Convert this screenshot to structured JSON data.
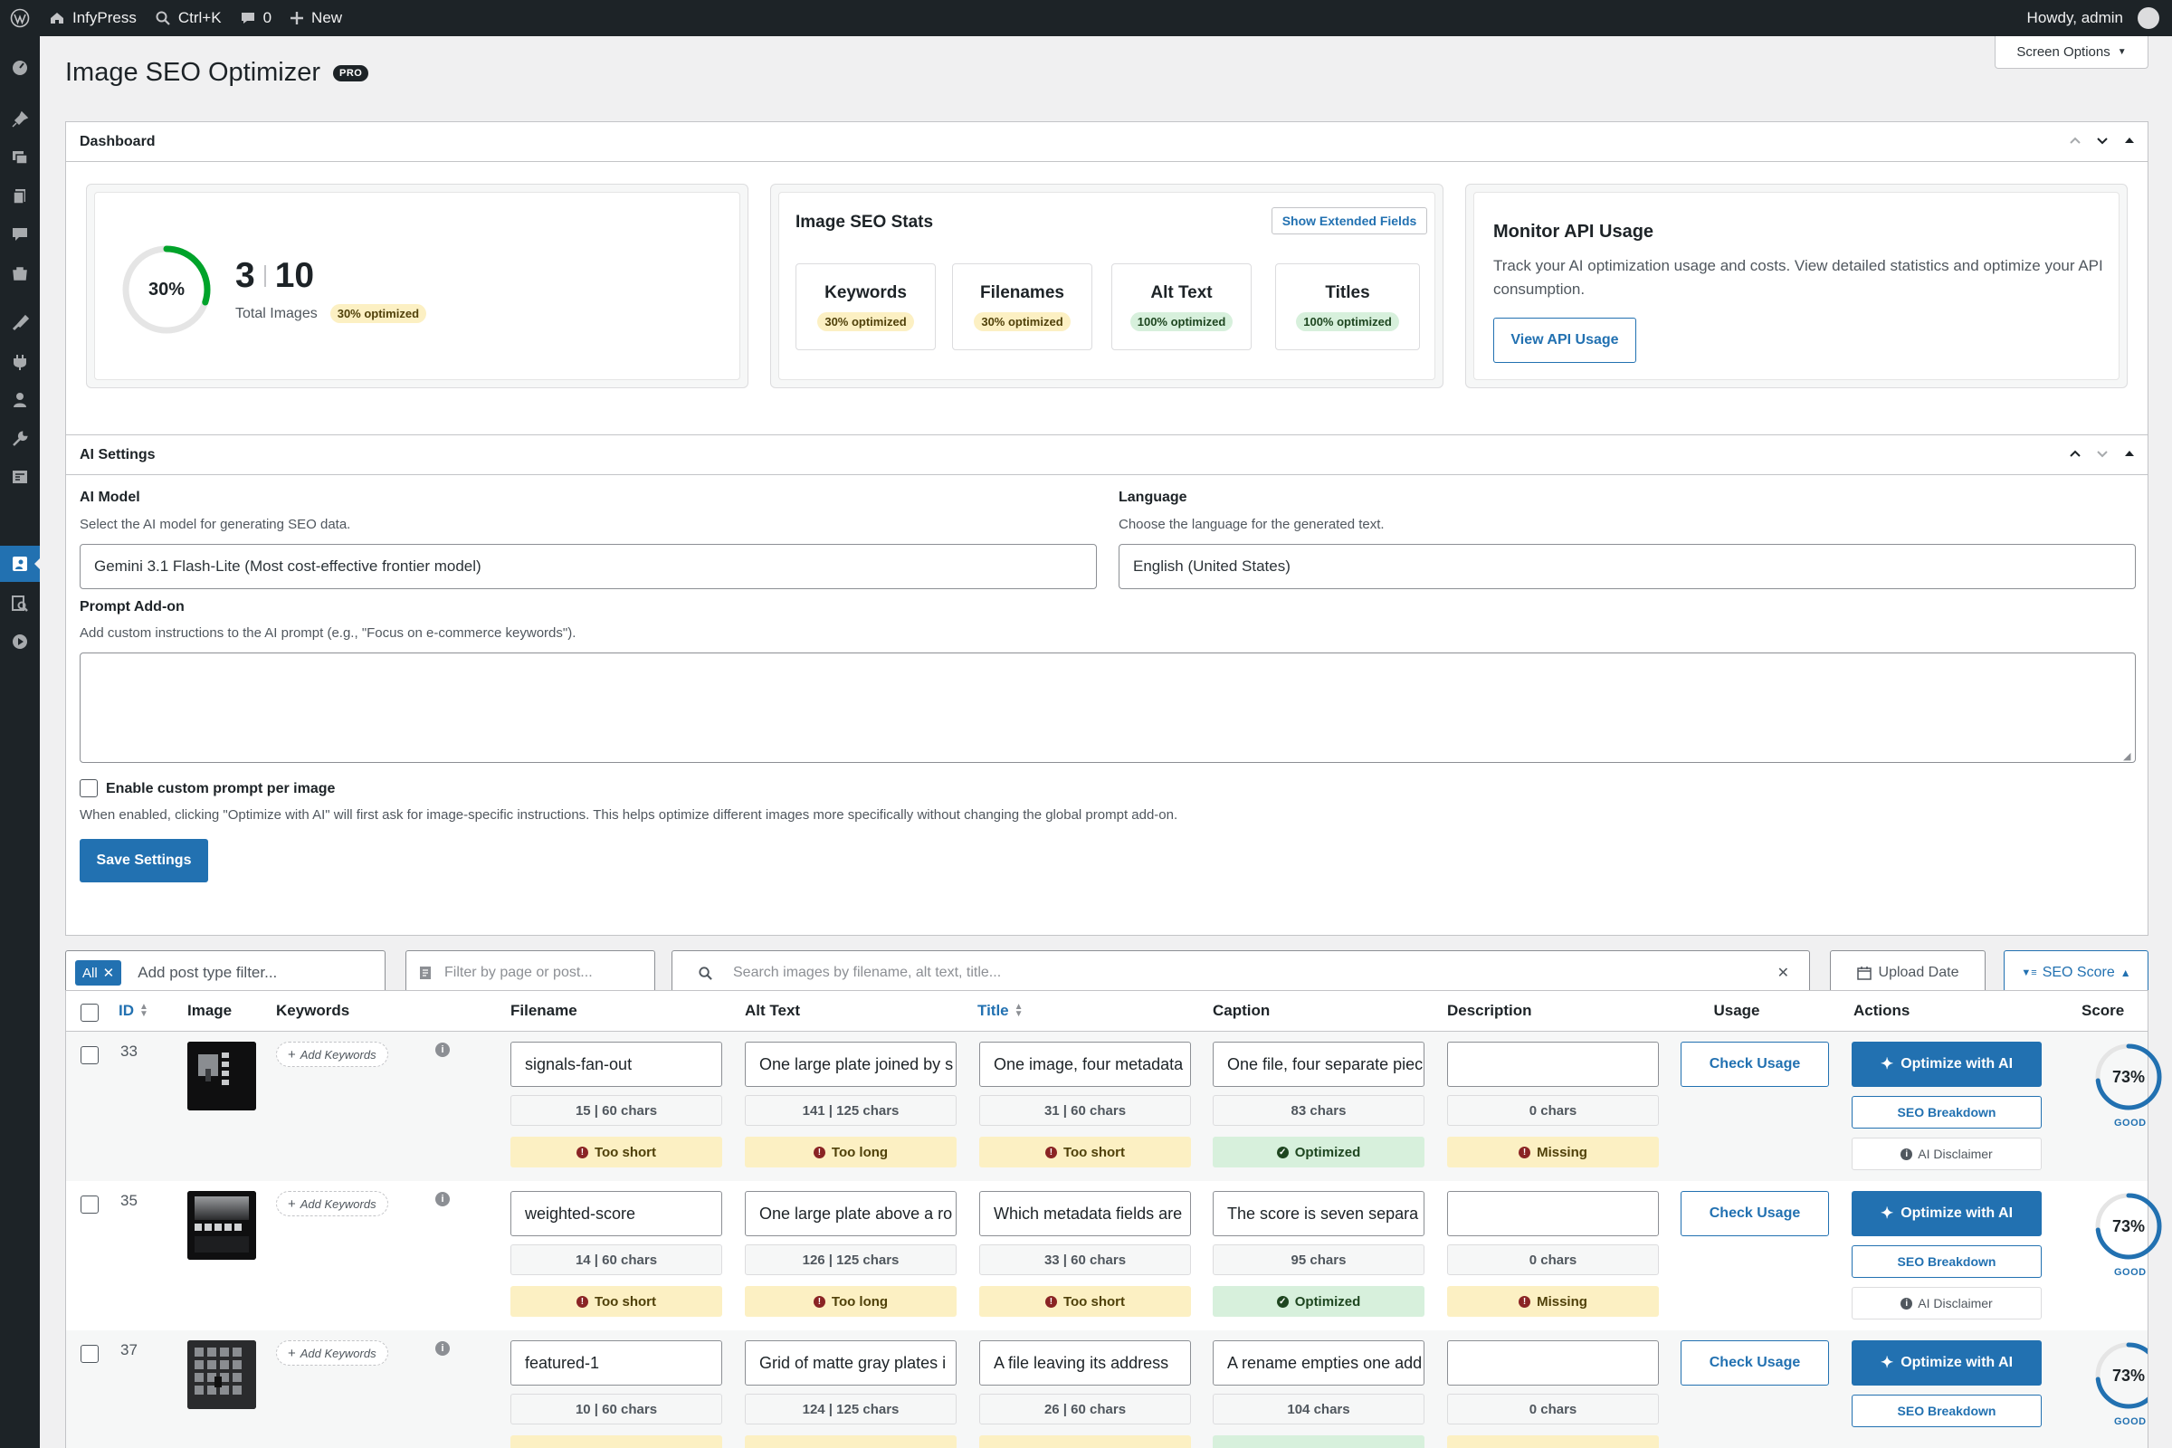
{
  "adminbar": {
    "site_name": "InfyPress",
    "search_shortcut": "Ctrl+K",
    "comments_count": "0",
    "new_label": "New",
    "howdy": "Howdy, admin"
  },
  "page": {
    "title": "Image SEO Optimizer",
    "pro_badge": "PRO",
    "screen_options": "Screen Options"
  },
  "dashboard": {
    "title": "Dashboard",
    "progress_percent_label": "30%",
    "progress_fraction": 0.3,
    "optimized_count": "3",
    "total_count": "10",
    "total_images_label": "Total Images",
    "optimized_badge": "30% optimized",
    "stats_title": "Image SEO Stats",
    "show_extended_fields": "Show Extended Fields",
    "stats": [
      {
        "label": "Keywords",
        "badge": "30% optimized"
      },
      {
        "label": "Filenames",
        "badge": "30% optimized"
      },
      {
        "label": "Alt Text",
        "badge": "100% optimized"
      },
      {
        "label": "Titles",
        "badge": "100% optimized"
      }
    ],
    "api_title": "Monitor API Usage",
    "api_desc": "Track your AI optimization usage and costs. View detailed statistics and optimize your API consumption.",
    "api_button": "View API Usage"
  },
  "ai_settings": {
    "title": "AI Settings",
    "model_label": "AI Model",
    "model_desc": "Select the AI model for generating SEO data.",
    "model_value": "Gemini 3.1 Flash-Lite (Most cost-effective frontier model)",
    "language_label": "Language",
    "language_desc": "Choose the language for the generated text.",
    "language_value": "English (United States)",
    "prompt_label": "Prompt Add-on",
    "prompt_desc": "Add custom instructions to the AI prompt (e.g., \"Focus on e-commerce keywords\").",
    "prompt_value": "",
    "custom_prompt_label": "Enable custom prompt per image",
    "custom_prompt_desc": "When enabled, clicking \"Optimize with AI\" will first ask for image-specific instructions. This helps optimize different images more specifically without changing the global prompt add-on.",
    "save_button": "Save Settings"
  },
  "filters": {
    "all_tag": "All",
    "post_type_placeholder": "Add post type filter...",
    "page_filter_placeholder": "Filter by page or post...",
    "search_placeholder": "Search images by filename, alt text, title...",
    "upload_date": "Upload Date",
    "seo_score": "SEO Score"
  },
  "table": {
    "headers": {
      "id": "ID",
      "image": "Image",
      "keywords": "Keywords",
      "filename": "Filename",
      "alt": "Alt Text",
      "title": "Title",
      "caption": "Caption",
      "description": "Description",
      "usage": "Usage",
      "actions": "Actions",
      "score": "Score"
    },
    "add_keywords": "Add Keywords",
    "check_usage": "Check Usage",
    "optimize": "Optimize with AI",
    "seo_breakdown": "SEO Breakdown",
    "ai_disclaimer": "AI Disclaimer",
    "rows": [
      {
        "id": "33",
        "filename": "signals-fan-out",
        "filename_chars": "15 | 60 chars",
        "filename_status": "Too short",
        "alt": "One large plate joined by s",
        "alt_chars": "141 | 125 chars",
        "alt_status": "Too long",
        "title": "One image, four metadata",
        "title_chars": "31 | 60 chars",
        "title_status": "Too short",
        "caption": "One file, four separate piec",
        "caption_chars": "83 chars",
        "caption_status": "Optimized",
        "description": "",
        "description_chars": "0 chars",
        "description_status": "Missing",
        "score_label": "73%",
        "score_fraction": 0.73,
        "score_grade": "GOOD"
      },
      {
        "id": "35",
        "filename": "weighted-score",
        "filename_chars": "14 | 60 chars",
        "filename_status": "Too short",
        "alt": "One large plate above a ro",
        "alt_chars": "126 | 125 chars",
        "alt_status": "Too long",
        "title": "Which metadata fields are",
        "title_chars": "33 | 60 chars",
        "title_status": "Too short",
        "caption": "The score is seven separa",
        "caption_chars": "95 chars",
        "caption_status": "Optimized",
        "description": "",
        "description_chars": "0 chars",
        "description_status": "Missing",
        "score_label": "73%",
        "score_fraction": 0.73,
        "score_grade": "GOOD"
      },
      {
        "id": "37",
        "filename": "featured-1",
        "filename_chars": "10 | 60 chars",
        "alt": "Grid of matte gray plates i",
        "alt_chars": "124 | 125 chars",
        "title": "A file leaving its address",
        "title_chars": "26 | 60 chars",
        "caption": "A rename empties one add",
        "caption_chars": "104 chars",
        "description": "",
        "description_chars": "0 chars",
        "score_label": "73%",
        "score_fraction": 0.73,
        "score_grade": "GOOD"
      }
    ]
  }
}
